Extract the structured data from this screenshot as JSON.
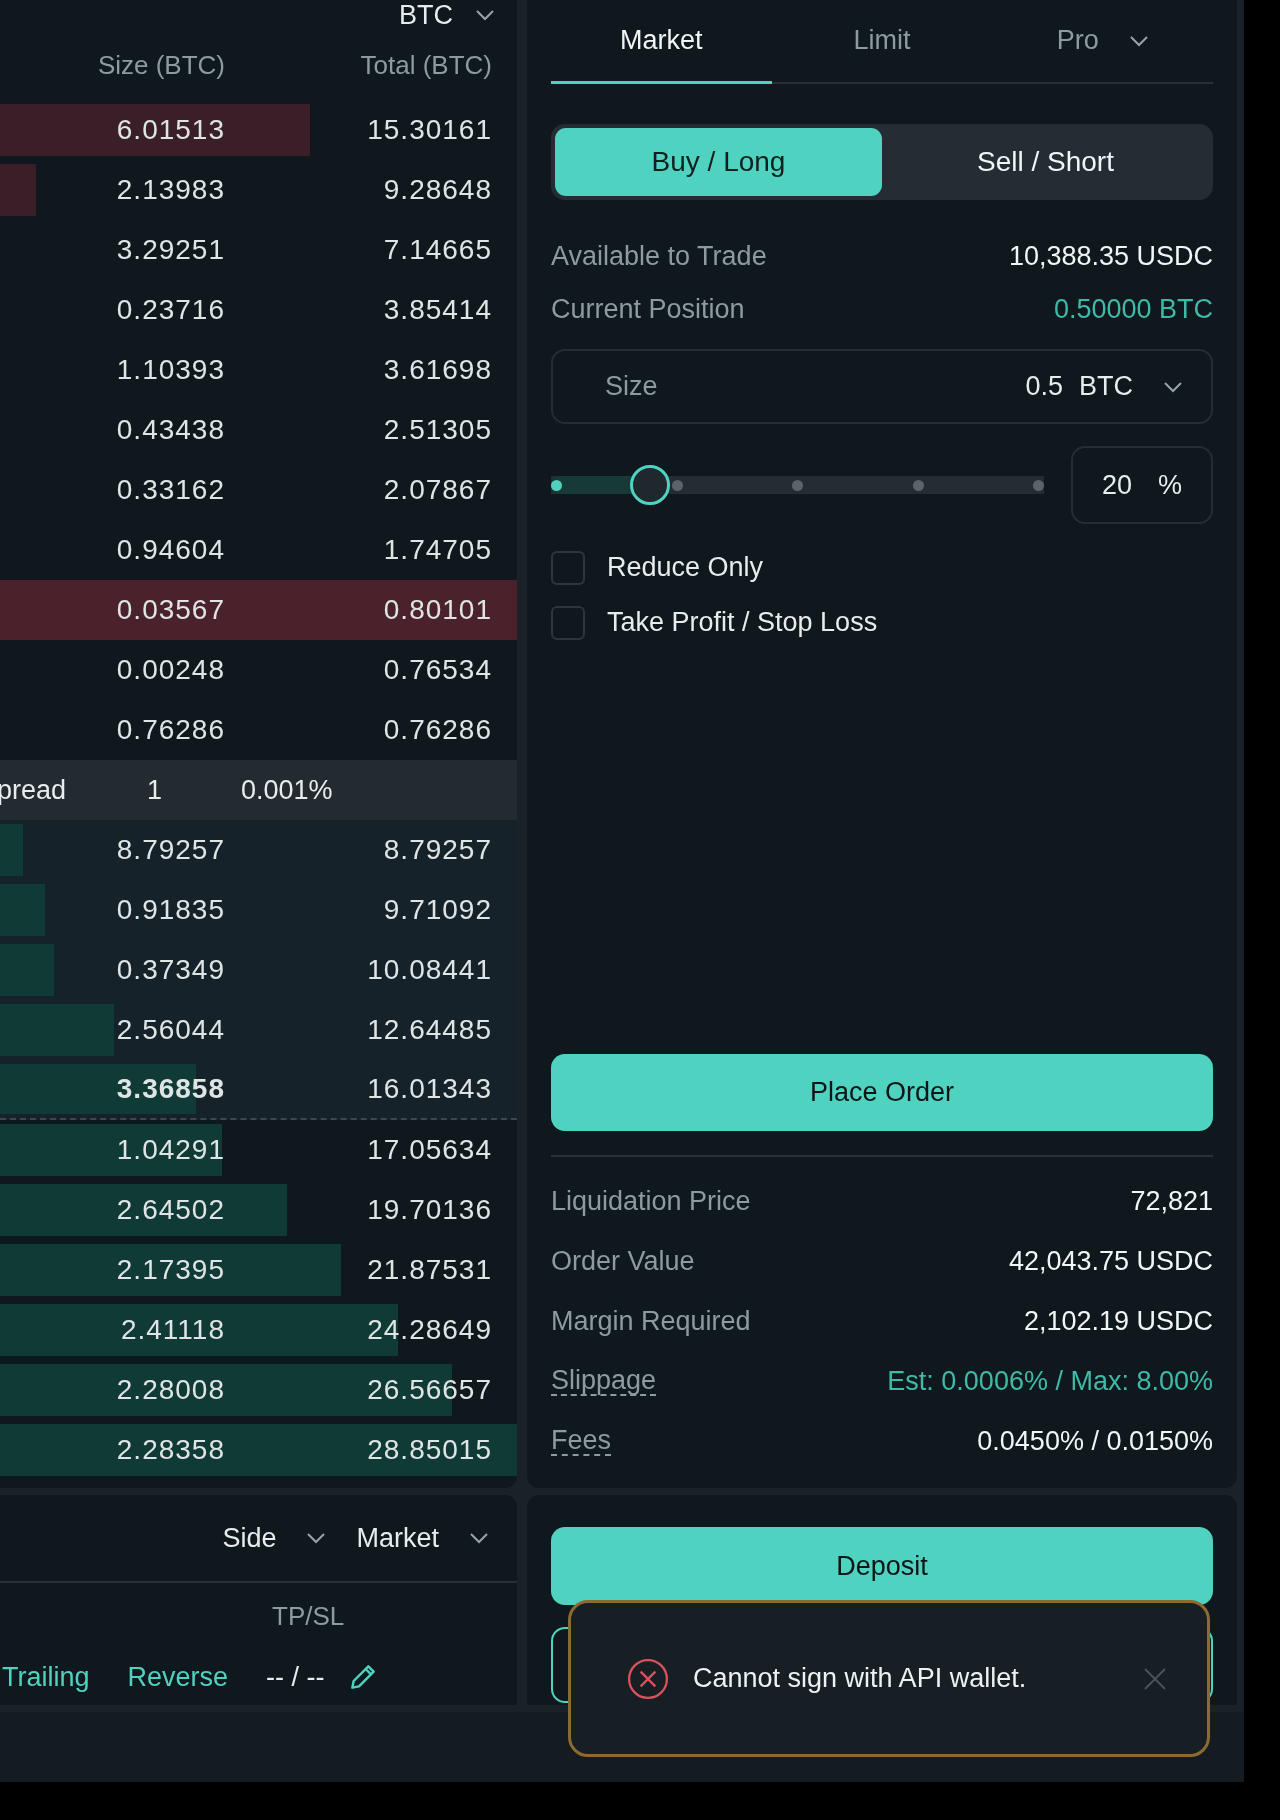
{
  "order_book": {
    "unit_select": "BTC",
    "columns": [
      "Size (BTC)",
      "Total (BTC)"
    ],
    "asks": [
      {
        "size": "6.01513",
        "total": "15.30161",
        "level": 0.6,
        "highlighted": false
      },
      {
        "size": "2.13983",
        "total": "9.28648",
        "level": 0.07,
        "highlighted": false
      },
      {
        "size": "3.29251",
        "total": "7.14665",
        "highlighted": false
      },
      {
        "size": "0.23716",
        "total": "3.85414",
        "highlighted": false
      },
      {
        "size": "1.10393",
        "total": "3.61698",
        "highlighted": false
      },
      {
        "size": "0.43438",
        "total": "2.51305",
        "highlighted": false
      },
      {
        "size": "0.33162",
        "total": "2.07867",
        "highlighted": false
      },
      {
        "size": "0.94604",
        "total": "1.74705",
        "highlighted": false
      },
      {
        "size": "0.03567",
        "total": "0.80101",
        "highlighted": true
      },
      {
        "size": "0.00248",
        "total": "0.76534",
        "highlighted": false
      },
      {
        "size": "0.76286",
        "total": "0.76286",
        "highlighted": false
      }
    ],
    "spread": {
      "label": "pread",
      "value": "1",
      "percent": "0.001%"
    },
    "bids": [
      {
        "size": "8.79257",
        "total": "8.79257",
        "level": 0.045,
        "highlighted": true,
        "emphasized": false
      },
      {
        "size": "0.91835",
        "total": "9.71092",
        "level": 0.087,
        "highlighted": true,
        "emphasized": false
      },
      {
        "size": "0.37349",
        "total": "10.08441",
        "level": 0.105,
        "highlighted": true,
        "emphasized": false
      },
      {
        "size": "2.56044",
        "total": "12.64485",
        "level": 0.22,
        "highlighted": true,
        "emphasized": false
      },
      {
        "size": "3.36858",
        "total": "16.01343",
        "level": 0.38,
        "highlighted": true,
        "emphasized": true
      },
      {
        "size": "1.04291",
        "total": "17.05634",
        "level": 0.43,
        "highlighted": false,
        "emphasized": false
      },
      {
        "size": "2.64502",
        "total": "19.70136",
        "level": 0.555,
        "highlighted": false,
        "emphasized": false
      },
      {
        "size": "2.17395",
        "total": "21.87531",
        "level": 0.66,
        "highlighted": false,
        "emphasized": false
      },
      {
        "size": "2.41118",
        "total": "24.28649",
        "level": 0.77,
        "highlighted": false,
        "emphasized": false
      },
      {
        "size": "2.28008",
        "total": "26.56657",
        "level": 0.875,
        "highlighted": false,
        "emphasized": false
      },
      {
        "size": "2.28358",
        "total": "28.85015",
        "level": 1,
        "highlighted": false,
        "emphasized": false
      }
    ]
  },
  "order_form": {
    "tabs": [
      {
        "label": "Market",
        "selected": true,
        "dropdown": false
      },
      {
        "label": "Limit",
        "selected": false,
        "dropdown": false
      },
      {
        "label": "Pro",
        "selected": false,
        "dropdown": true
      }
    ],
    "sides": [
      {
        "label": "Buy / Long",
        "selected": true
      },
      {
        "label": "Sell / Short",
        "selected": false
      }
    ],
    "account_info": [
      {
        "label": "Available to Trade",
        "value": "10,388.35 USDC",
        "accent": false
      },
      {
        "label": "Current Position",
        "value": "0.50000 BTC",
        "accent": true
      }
    ],
    "size_field": {
      "label": "Size",
      "value": "0.5",
      "unit": "BTC"
    },
    "size_slider": {
      "level": 0.2,
      "percent": "20",
      "unit": "%"
    },
    "options": [
      {
        "label": "Reduce Only",
        "checked": false
      },
      {
        "label": "Take Profit / Stop Loss",
        "checked": false
      }
    ],
    "submit_button": "Place Order",
    "summary": [
      {
        "label": "Liquidation Price",
        "value": "72,821",
        "accent": false,
        "tooltip": false
      },
      {
        "label": "Order Value",
        "value": "42,043.75 USDC",
        "accent": false,
        "tooltip": false
      },
      {
        "label": "Margin Required",
        "value": "2,102.19 USDC",
        "accent": false,
        "tooltip": false
      },
      {
        "label": "Slippage",
        "value": "Est: 0.0006% / Max: 8.00%",
        "accent": true,
        "tooltip": true
      },
      {
        "label": "Fees",
        "value": "0.0450% / 0.0150%",
        "accent": false,
        "tooltip": true
      }
    ]
  },
  "positions_panel": {
    "filters": [
      "Side",
      "Market"
    ],
    "columns": [
      "TP/SL"
    ],
    "row": {
      "actions": [
        "Trailing",
        "Reverse"
      ],
      "tp_sl": "-- / --"
    }
  },
  "wallet_panel": {
    "deposit_button": "Deposit"
  },
  "toast": {
    "kind": "error",
    "message": "Cannot sign with API wallet."
  }
}
